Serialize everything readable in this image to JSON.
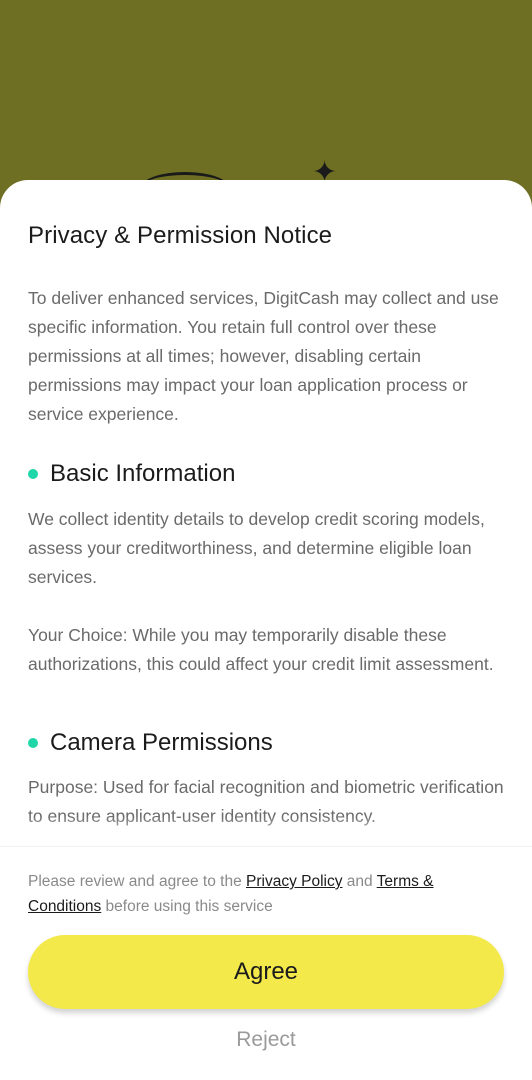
{
  "notice": {
    "title": "Privacy & Permission Notice",
    "intro": "To deliver enhanced services, DigitCash may collect and use specific information. You retain full control over these permissions at all times; however, disabling certain permissions may impact your loan application process or service experience.",
    "sections": [
      {
        "heading": "Basic Information",
        "paragraphs": [
          "We collect identity details to develop credit scoring models, assess your creditworthiness, and determine eligible loan services.",
          "Your Choice: While you may temporarily disable these authorizations, this could affect your credit limit assessment."
        ]
      },
      {
        "heading": "Camera Permissions",
        "paragraphs": [
          "Purpose: Used for facial recognition and biometric verification to ensure applicant-user identity consistency."
        ]
      }
    ]
  },
  "footer": {
    "consent_prefix": "Please review and agree to the ",
    "privacy_link": "Privacy Policy",
    "consent_and": " and ",
    "terms_link": "Terms & Conditions",
    "consent_suffix": " before using this service",
    "agree_label": "Agree",
    "reject_label": "Reject"
  },
  "colors": {
    "backdrop": "#6f6f24",
    "accent_bullet": "#1ed6a8",
    "agree_button": "#f4e94a"
  }
}
